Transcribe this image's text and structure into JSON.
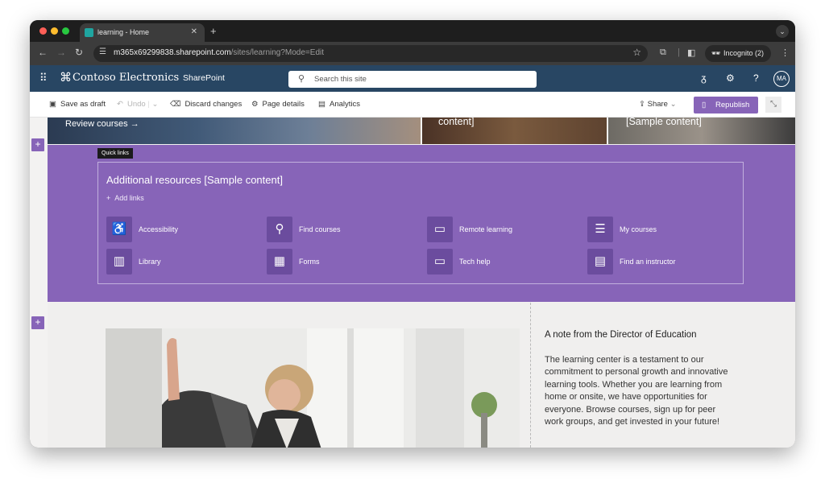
{
  "browser": {
    "tab_title": "learning - Home",
    "url_domain": "m365x69299838.sharepoint.com",
    "url_path": "/sites/learning?Mode=Edit",
    "incognito_label": "Incognito (2)"
  },
  "suitebar": {
    "brand": "Contoso Electronics",
    "app_name": "SharePoint",
    "search_placeholder": "Search this site",
    "avatar_initials": "MA"
  },
  "commandbar": {
    "save_draft": "Save as draft",
    "undo": "Undo",
    "discard": "Discard changes",
    "page_details": "Page details",
    "analytics": "Analytics",
    "share": "Share",
    "republish": "Republish"
  },
  "hero": {
    "review_courses": "Review courses",
    "tile2_text": "content]",
    "tile3_text": "[Sample content]"
  },
  "quicklinks": {
    "tag": "Quick links",
    "title": "Additional resources [Sample content]",
    "add_links": "Add links",
    "items": [
      {
        "label": "Accessibility",
        "icon": "accessibility-icon"
      },
      {
        "label": "Find courses",
        "icon": "search-icon"
      },
      {
        "label": "Remote learning",
        "icon": "remote-learning-icon"
      },
      {
        "label": "My courses",
        "icon": "checklist-icon"
      },
      {
        "label": "Library",
        "icon": "library-icon"
      },
      {
        "label": "Forms",
        "icon": "forms-icon"
      },
      {
        "label": "Tech help",
        "icon": "tech-help-icon"
      },
      {
        "label": "Find an instructor",
        "icon": "clipboard-icon"
      }
    ]
  },
  "note": {
    "title": "A note from the Director of Education",
    "body": "The learning center is a testament to our commitment to personal growth and innovative learning tools. Whether you are learning from home or onsite, we have opportunities for everyone. Browse courses, sign up for peer work groups, and get invested in your future!"
  },
  "colors": {
    "suitebar": "#284663",
    "accent": "#8764b8"
  }
}
